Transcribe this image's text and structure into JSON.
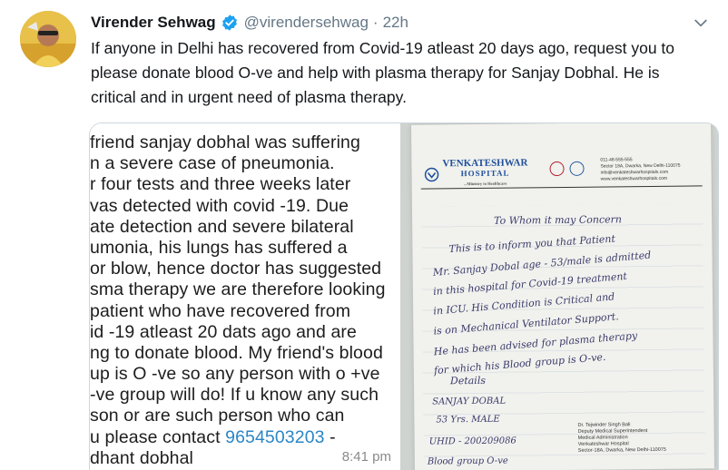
{
  "tweet": {
    "author_name": "Virender Sehwag",
    "author_handle": "@virendersehwag",
    "separator": "·",
    "time": "22h",
    "verified_icon": "verified-badge-icon",
    "more_icon": "chevron-down-icon",
    "text": "If anyone in Delhi has recovered from Covid-19 atleast 20 days ago, request you to please donate blood O-ve and help with plasma therapy for Sanjay Dobhal. He is critical and in urgent need of plasma therapy.",
    "accent_color": "#1da1f2"
  },
  "media": {
    "chat_lines": [
      "friend sanjay dobhal was suffering",
      "n a severe case of pneumonia.",
      "r four tests and three weeks later",
      "vas detected with covid -19. Due",
      "ate detection and severe bilateral",
      "umonia, his lungs has suffered a",
      "or blow, hence doctor has suggested",
      "sma therapy we are therefore looking",
      "patient who have recovered from",
      "id -19 atleast 20 dats ago and are",
      "ng to donate blood. My friend's  blood",
      "up is O -ve so any person with o +ve",
      "-ve group will do! If u know any such",
      "son or are such person who can",
      "u please contact "
    ],
    "chat_phone": "9654503203",
    "chat_phone_suffix": " -",
    "chat_last_line": "dhant dobhal",
    "chat_time": "8:41 pm",
    "letter": {
      "hospital_name": "VENKATESHWAR",
      "hospital_sub": "HOSPITAL",
      "hospital_tag": "...Ministry to Healthcare",
      "contact_lines": [
        "011-48-555-555",
        "Sector 18A, Dwarka, New Delhi-110075",
        "info@venkateshwarhospitals.com",
        "www.venkateshwarhospitals.com"
      ],
      "salutation": "To Whom it may Concern",
      "body_lines": [
        "This is to inform you that Patient",
        "Mr. Sanjay Dobal age - 53/male is admitted",
        "in this hospital for Covid-19 treatment",
        "in ICU. His Condition is Critical and",
        "is on Mechanical Ventilator Support.",
        "He has been advised for plasma therapy",
        "for which his Blood group is O-ve."
      ],
      "details_heading": "Details",
      "details_lines": [
        "SANJAY DOBAL",
        "53 Yrs. MALE",
        "UHID - 200209086",
        "Blood group O-ve"
      ],
      "signature_lines": [
        "Dr. Tejwinder Singh Bali",
        "Deputy Medical Superintendent",
        "Medical Administration",
        "Venkateshwar Hospital",
        "Sector-18A, Dwarka, New Delhi-110075"
      ]
    }
  }
}
